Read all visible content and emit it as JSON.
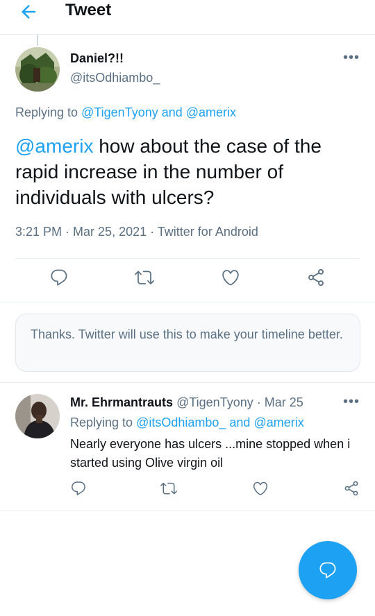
{
  "header": {
    "title": "Tweet",
    "back_icon": "arrow-left-icon"
  },
  "main_tweet": {
    "display_name": "Daniel?!!",
    "handle": "@itsOdhiambo_",
    "replying_prefix": "Replying to ",
    "replying_to_1": "@TigenTyony",
    "replying_and": " and ",
    "replying_to_2": "@amerix",
    "mention": "@amerix",
    "text": " how about the case of the rapid increase in the number of individuals with ulcers?",
    "time": "3:21 PM",
    "date": "Mar 25, 2021",
    "source": "Twitter for Android",
    "meta_sep": " · "
  },
  "notice": {
    "text": "Thanks. Twitter will use this to make your timeline better."
  },
  "reply": {
    "display_name": "Mr. Ehrmantrauts",
    "handle": "@TigenTyony",
    "date_sep": " · ",
    "date": "Mar 25",
    "replying_prefix": "Replying to ",
    "replying_to_1": "@itsOdhiambo_",
    "replying_and": " and ",
    "replying_to_2": "@amerix",
    "text": "Nearly everyone has ulcers ...mine stopped when i started using Olive virgin oil"
  },
  "icons": [
    "reply-icon",
    "retweet-icon",
    "like-icon",
    "share-icon",
    "more-icon",
    "compose-icon"
  ],
  "colors": {
    "accent": "#1da1f2",
    "secondary_text": "#5b7083",
    "divider": "#e6ecf0"
  },
  "more_label": "•••"
}
